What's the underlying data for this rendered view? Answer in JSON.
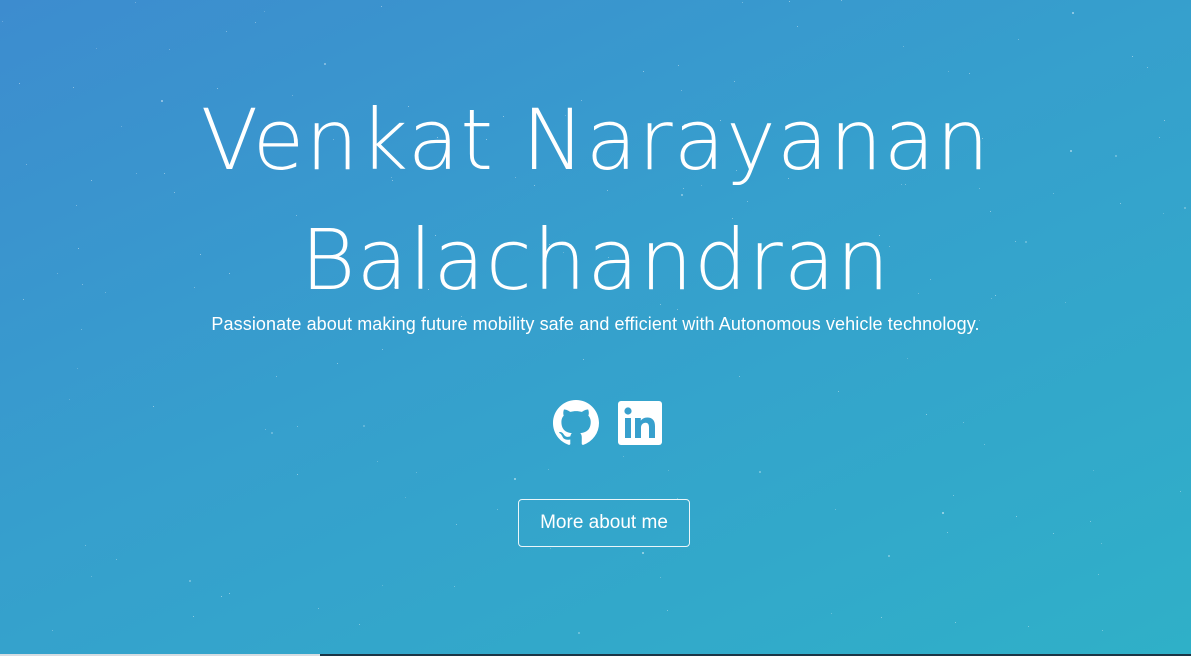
{
  "hero": {
    "title_line1": "Venkat Narayanan",
    "title_line2": "Balachandran",
    "tagline": "Passionate about making future mobility safe and efficient with Autonomous vehicle technology.",
    "cta_label": "More about me"
  },
  "socials": [
    {
      "name": "github",
      "icon": "github-icon"
    },
    {
      "name": "linkedin",
      "icon": "linkedin-icon"
    }
  ],
  "colors": {
    "gradient_start": "#3d8ccf",
    "gradient_end": "#2fb0c8",
    "text": "#ffffff"
  }
}
